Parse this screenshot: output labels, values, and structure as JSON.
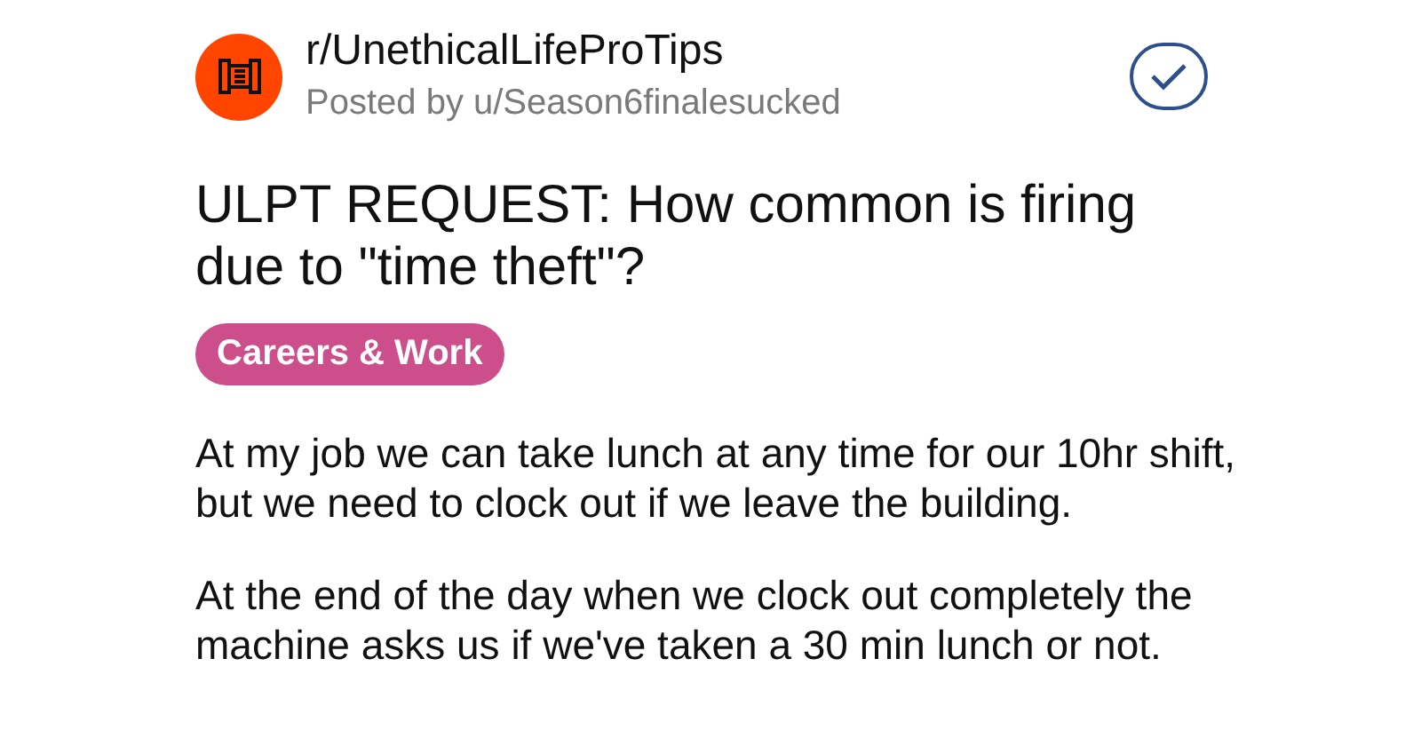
{
  "post": {
    "subreddit": "r/UnethicalLifeProTips",
    "author": "Posted by u/Season6finalesucked",
    "joined": true,
    "title": "ULPT REQUEST: How common is firing due to \"time theft\"?",
    "flair": {
      "label": "Careers & Work",
      "color": "#cc4f8c"
    },
    "body": [
      "At my job we can take lunch at any time for our 10hr shift, but we need to clock out if we leave the building.",
      "At the end of the day when we clock out completely the machine asks us if we've taken a 30 min lunch or not."
    ]
  }
}
